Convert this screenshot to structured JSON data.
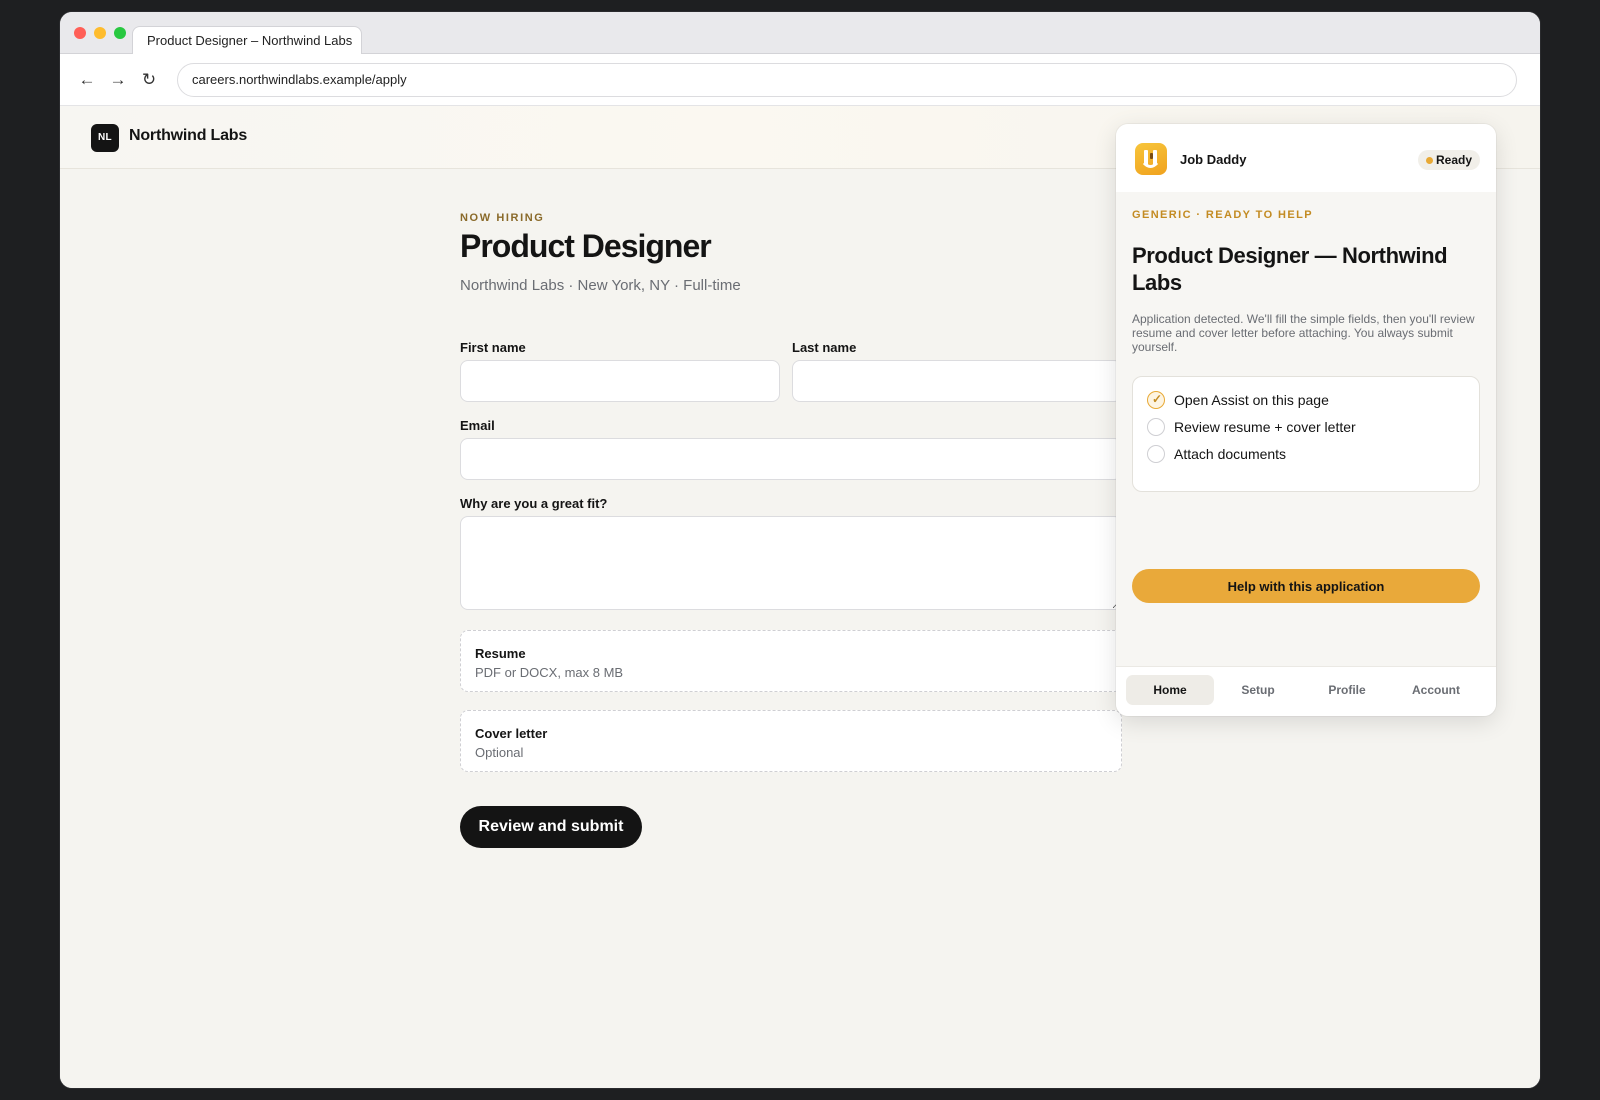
{
  "browser": {
    "tab_title": "Product Designer – Northwind Labs",
    "url": "careers.northwindlabs.example/apply",
    "back_glyph": "←",
    "forward_glyph": "→",
    "reload_glyph": "↻",
    "light_colors": [
      "#ff5f57",
      "#febc2e",
      "#28c840"
    ]
  },
  "site": {
    "logo_text": "NL",
    "name": "Northwind Labs"
  },
  "job": {
    "eyebrow": "NOW HIRING",
    "title": "Product Designer",
    "meta": "Northwind Labs · New York, NY · Full-time"
  },
  "form": {
    "first_name_label": "First name",
    "last_name_label": "Last name",
    "email_label": "Email",
    "fit_label": "Why are you a great fit?",
    "first_name_value": "",
    "last_name_value": "",
    "email_value": "",
    "fit_value": "",
    "resume": {
      "title": "Resume",
      "subtitle": "PDF or DOCX, max 8 MB"
    },
    "cover_letter": {
      "title": "Cover letter",
      "subtitle": "Optional"
    },
    "submit_label": "Review and submit"
  },
  "assistant": {
    "app_name": "Job Daddy",
    "status": "Ready",
    "status_color": "#e8a935",
    "eyebrow": "GENERIC · READY TO HELP",
    "title": "Product Designer — Northwind Labs",
    "description": "Application detected. We'll fill the simple fields, then you'll review resume and cover letter before attaching. You always submit yourself.",
    "checklist": [
      {
        "label": "Open Assist on this page",
        "done": true
      },
      {
        "label": "Review resume + cover letter",
        "done": false
      },
      {
        "label": "Attach documents",
        "done": false
      }
    ],
    "check_glyph": "✓",
    "help_button": "Help with this application",
    "accent_color": "#e9a93a",
    "tabs": [
      {
        "label": "Home",
        "active": true
      },
      {
        "label": "Setup",
        "active": false
      },
      {
        "label": "Profile",
        "active": false
      },
      {
        "label": "Account",
        "active": false
      }
    ]
  }
}
